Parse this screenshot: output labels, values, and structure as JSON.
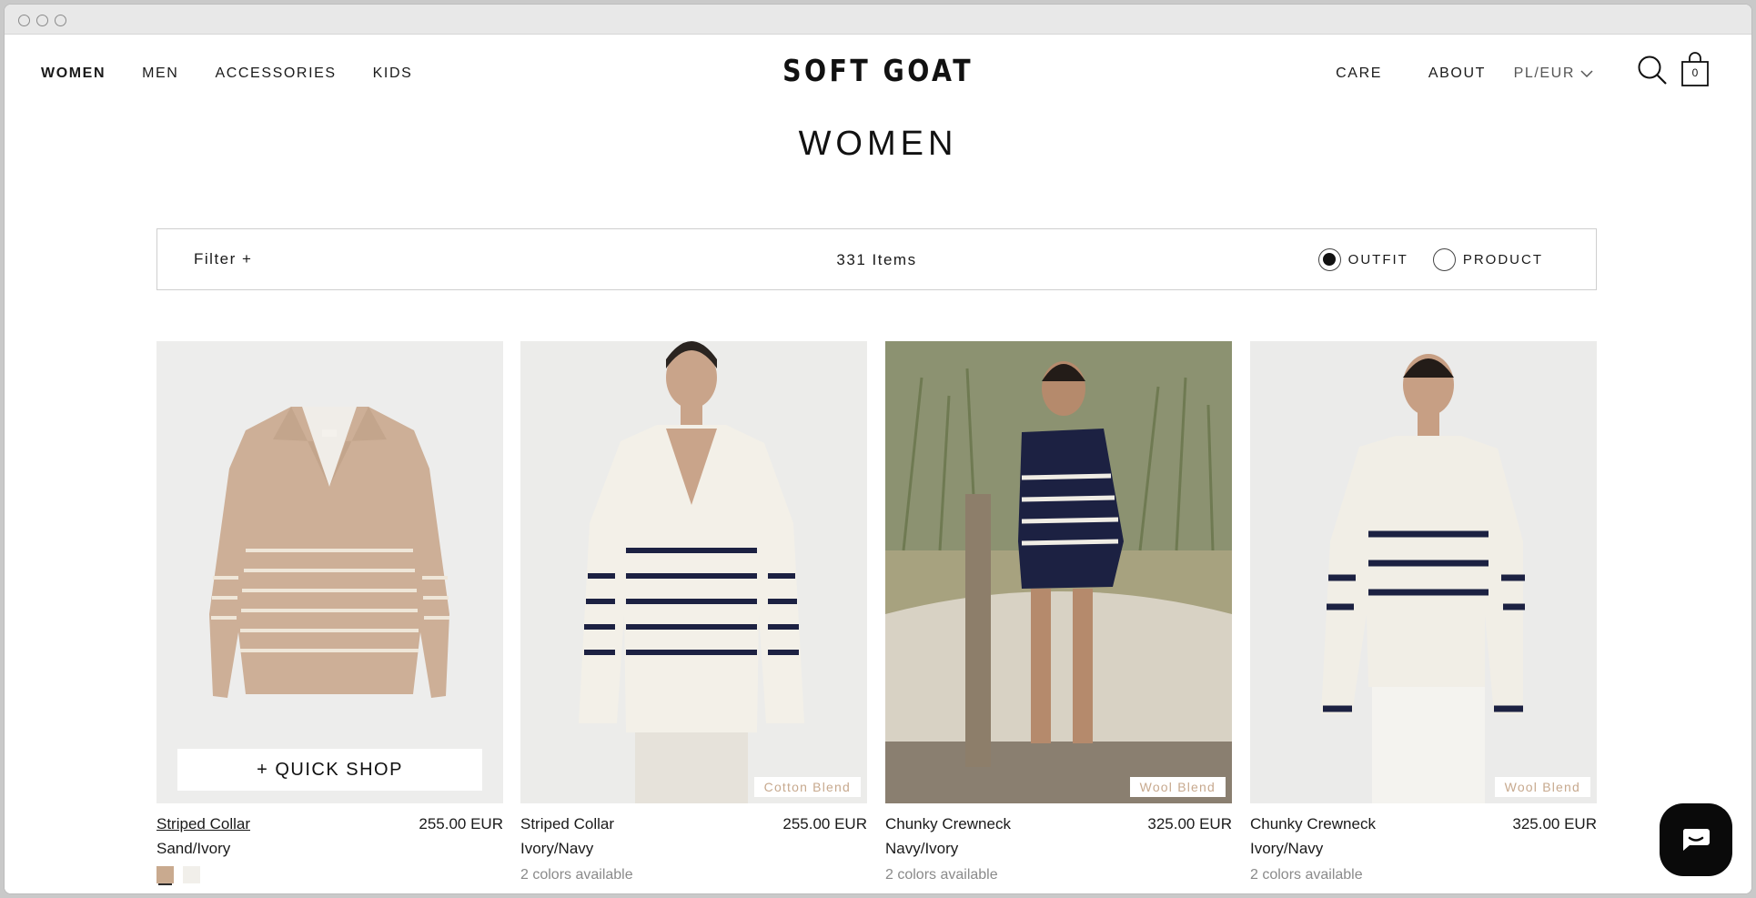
{
  "window": {
    "controls": [
      "close",
      "minimize",
      "zoom"
    ]
  },
  "header": {
    "nav_left": [
      "WOMEN",
      "MEN",
      "ACCESSORIES",
      "KIDS"
    ],
    "logo": "SOFT GOAT",
    "care": "CARE",
    "about": "ABOUT",
    "locale": "PL/EUR",
    "cart_count": "0"
  },
  "page": {
    "title": "WOMEN"
  },
  "filterbar": {
    "filter_label": "Filter +",
    "item_count": "331 Items",
    "view_options": [
      "OUTFIT",
      "PRODUCT"
    ],
    "selected_view": "OUTFIT"
  },
  "products": [
    {
      "name": "Striped Collar",
      "color": "Sand/Ivory",
      "price": "255.00 EUR",
      "quick_shop": "+ QUICK SHOP",
      "swatches": [
        {
          "name": "sand",
          "hex": "#c9aa8f"
        },
        {
          "name": "ivory",
          "hex": "#f1efea"
        }
      ]
    },
    {
      "name": "Striped Collar",
      "color": "Ivory/Navy",
      "price": "255.00 EUR",
      "availability": "2 colors available",
      "tag": "Cotton Blend"
    },
    {
      "name": "Chunky Crewneck",
      "color": "Navy/Ivory",
      "price": "325.00 EUR",
      "availability": "2 colors available",
      "tag": "Wool Blend"
    },
    {
      "name": "Chunky Crewneck",
      "color": "Ivory/Navy",
      "price": "325.00 EUR",
      "availability": "2 colors available",
      "tag": "Wool Blend"
    }
  ],
  "colors": {
    "tag_text": "#c7a98e",
    "navy": "#1c2142",
    "ivory": "#f3f0e8",
    "sand": "#c9aa8f"
  },
  "icons": [
    "search-icon",
    "shopping-bag-icon",
    "chevron-down-icon",
    "chat-icon"
  ]
}
